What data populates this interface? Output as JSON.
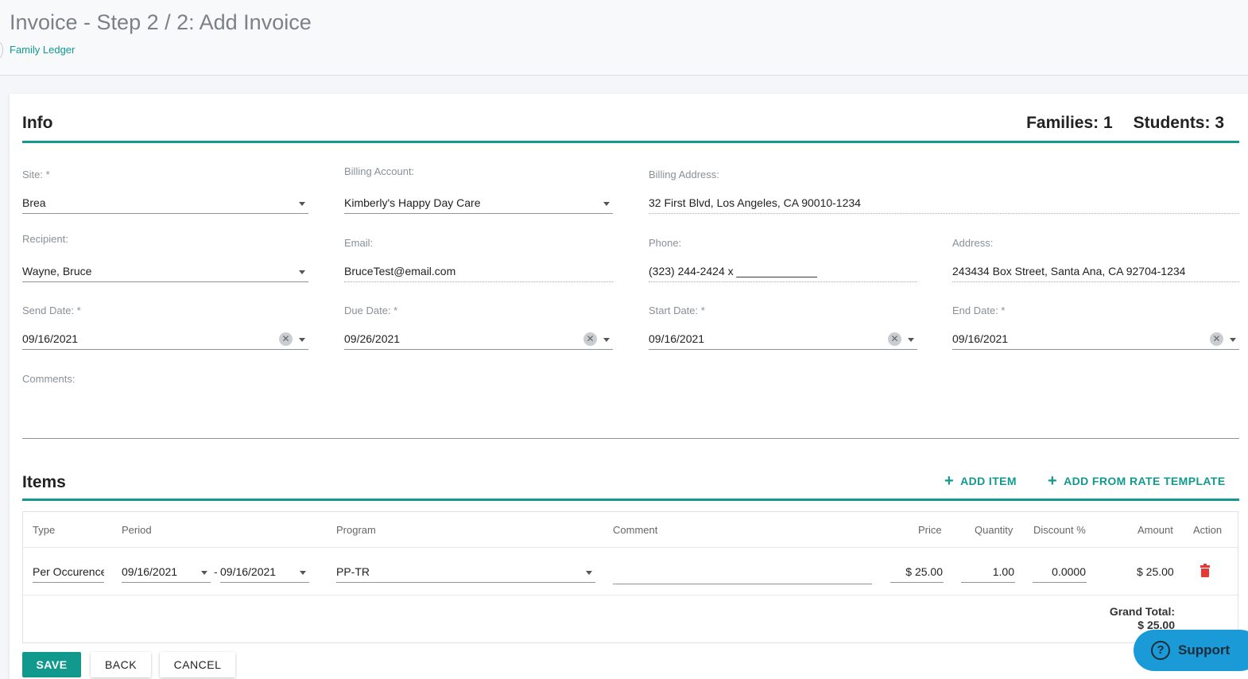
{
  "page": {
    "title": "Invoice - Step 2 / 2: Add Invoice",
    "breadcrumb": "Family Ledger"
  },
  "info": {
    "section_title": "Info",
    "families_label": "Families: 1",
    "students_label": "Students: 3",
    "site": {
      "label": "Site: *",
      "value": "Brea"
    },
    "billing_account": {
      "label": "Billing Account:",
      "value": "Kimberly's Happy Day Care"
    },
    "billing_address": {
      "label": "Billing Address:",
      "value": "32 First Blvd, Los Angeles, CA 90010-1234"
    },
    "recipient": {
      "label": "Recipient:",
      "value": "Wayne, Bruce"
    },
    "email": {
      "label": "Email:",
      "value": "BruceTest@email.com"
    },
    "phone": {
      "label": "Phone:",
      "value": "(323) 244-2424 x _____________"
    },
    "address": {
      "label": "Address:",
      "value": "243434 Box Street, Santa Ana, CA 92704-1234"
    },
    "send_date": {
      "label": "Send Date: *",
      "value": "09/16/2021"
    },
    "due_date": {
      "label": "Due Date: *",
      "value": "09/26/2021"
    },
    "start_date": {
      "label": "Start Date: *",
      "value": "09/16/2021"
    },
    "end_date": {
      "label": "End Date: *",
      "value": "09/16/2021"
    },
    "comments": {
      "label": "Comments:",
      "value": ""
    }
  },
  "items": {
    "section_title": "Items",
    "add_item_label": "ADD ITEM",
    "add_from_template_label": "ADD FROM RATE TEMPLATE",
    "columns": [
      "Type",
      "Period",
      "Program",
      "Comment",
      "Price",
      "Quantity",
      "Discount %",
      "Amount",
      "Action"
    ],
    "rows": [
      {
        "type": "Per Occurence",
        "period_start": "09/16/2021",
        "period_separator": "-",
        "period_end": "09/16/2021",
        "program": "PP-TR",
        "comment": "",
        "price": "$ 25.00",
        "quantity": "1.00",
        "discount": "0.0000",
        "amount": "$ 25.00"
      }
    ],
    "grand_total_label": "Grand Total:",
    "grand_total_value": "$ 25.00"
  },
  "buttons": {
    "save": "SAVE",
    "back": "BACK",
    "cancel": "CANCEL"
  },
  "support": {
    "label": "Support",
    "icon": "question-circle-icon"
  },
  "colors": {
    "accent": "#11998e",
    "delete": "#e53935",
    "support_bg": "#1a9bd7"
  }
}
